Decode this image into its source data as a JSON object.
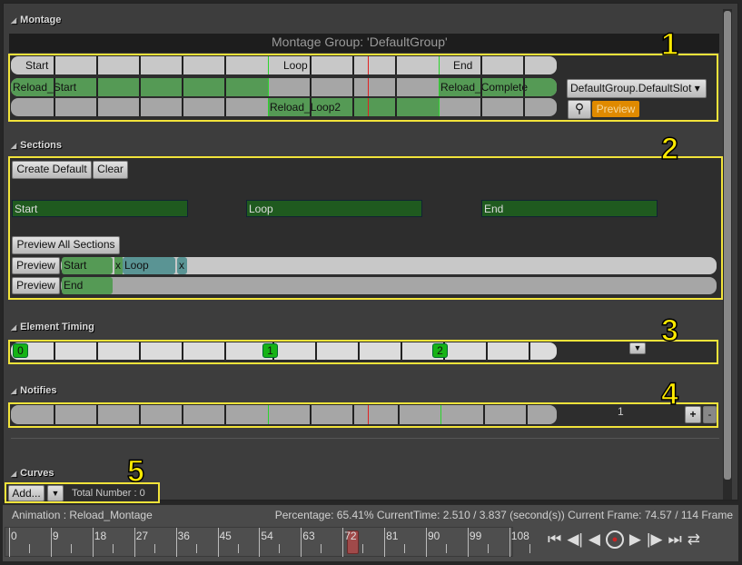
{
  "montage": {
    "header": "Montage",
    "group_title": "Montage Group: 'DefaultGroup'",
    "sections_row": [
      "Start",
      "Loop",
      "End"
    ],
    "slot_row1": [
      "Reload_Start",
      "Reload_Complete"
    ],
    "slot_row2": [
      "Reload_Loop2"
    ],
    "slot_dropdown": "DefaultGroup.DefaultSlot",
    "preview": "Preview",
    "callout": "1"
  },
  "sections": {
    "header": "Sections",
    "create_default": "Create Default",
    "clear": "Clear",
    "bars": [
      "Start",
      "Loop",
      "End"
    ],
    "preview_all": "Preview All Sections",
    "preview": "Preview",
    "chain1": [
      "Start",
      "x",
      "Loop",
      "x"
    ],
    "chain2": [
      "End"
    ],
    "callout": "2"
  },
  "element_timing": {
    "header": "Element Timing",
    "markers": [
      "0",
      "1",
      "2"
    ],
    "callout": "3"
  },
  "notifies": {
    "header": "Notifies",
    "track_count": "1",
    "add": "+",
    "remove": "-",
    "callout": "4"
  },
  "curves": {
    "header": "Curves",
    "add": "Add...",
    "total": "Total Number : 0",
    "callout": "5"
  },
  "status": {
    "animation": "Animation :  Reload_Montage",
    "info": "Percentage:  65.41% CurrentTime:  2.510 / 3.837 (second(s)) Current Frame:  74.57 / 114 Frame"
  },
  "timeline": {
    "ticks": [
      "0",
      "9",
      "18",
      "27",
      "36",
      "45",
      "54",
      "63",
      "72",
      "81",
      "90",
      "99",
      "108"
    ],
    "current_frame": 74.57,
    "total_frames": 114
  },
  "colors": {
    "highlight": "#f2e33a",
    "segment": "#559a55",
    "preview_btn": "#e08a00"
  }
}
